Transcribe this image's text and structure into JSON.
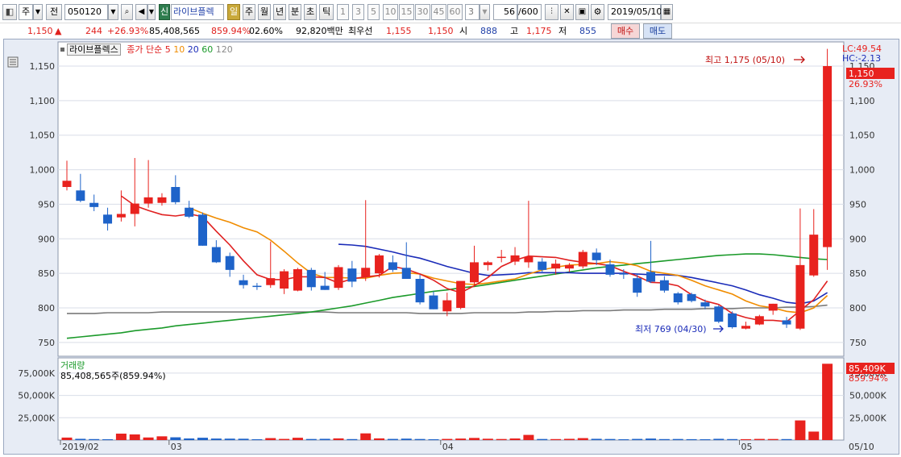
{
  "toolbar": {
    "market_label": "주",
    "prev_label": "전",
    "code_value": "050120",
    "sound_icon": "speaker-icon",
    "new_badge": "신",
    "stock_name": "라이브플렉",
    "periods": [
      "일",
      "주",
      "월",
      "년",
      "분",
      "초",
      "틱"
    ],
    "active_period": "일",
    "intervals": [
      "1",
      "3",
      "5",
      "10",
      "15",
      "30",
      "45",
      "60"
    ],
    "interval_value": "3",
    "count_value": "56",
    "count_max": "/600",
    "date_value": "2019/05/10"
  },
  "quote": {
    "price": "1,150",
    "arrow": "▲",
    "change": "244",
    "change_pct": "+26.93%",
    "volume": "85,408,565",
    "volume_ratio": "859.94%",
    "turnover": "02.60%",
    "amount": "92,820백만",
    "best_ask_label": "최우선",
    "best_ask": "1,155",
    "best_bid": "1,150",
    "open_label": "시",
    "open": "888",
    "high_label": "고",
    "high": "1,175",
    "low_label": "저",
    "low": "855",
    "buy_label": "매수",
    "sell_label": "매도"
  },
  "chart": {
    "stock_tag": "라이브플렉스",
    "ma_title": "종가 단순",
    "ma_periods": [
      "5",
      "10",
      "20",
      "60",
      "120"
    ],
    "lc_label": "LC:49.54",
    "hc_label": "HC:-2.13",
    "current_price_label": "1,150",
    "current_pct_label": "26.93%",
    "high_annotation": "최고 1,175 (05/10)",
    "low_annotation": "최저 769 (04/30)",
    "volume_title": "거래량",
    "volume_info": "85,408,565주(859.94%)",
    "volume_value_label": "85,409K",
    "volume_pct_label": "859.94%",
    "date_labels": [
      "2019/02",
      "03",
      "04",
      "05",
      "05/10"
    ],
    "colors": {
      "up": "#e8221e",
      "down": "#1e63c9",
      "ma5": "#e02020",
      "ma10": "#f08c00",
      "ma20": "#1a2bb8",
      "ma60": "#1b9a2a",
      "ma120": "#7a7a7a"
    }
  },
  "chart_data": {
    "type": "candlestick",
    "price_axis": {
      "ticks": [
        750,
        800,
        850,
        900,
        950,
        1000,
        1050,
        1100,
        1150
      ],
      "ylim": [
        730,
        1185
      ]
    },
    "volume_axis": {
      "ticks": [
        25000,
        50000,
        75000
      ],
      "unit": "K"
    },
    "candles": [
      {
        "o": 975,
        "h": 1013,
        "l": 970,
        "c": 984,
        "v": 2800
      },
      {
        "o": 970,
        "h": 994,
        "l": 953,
        "c": 955,
        "v": 1400
      },
      {
        "o": 952,
        "h": 964,
        "l": 940,
        "c": 946,
        "v": 1100
      },
      {
        "o": 935,
        "h": 945,
        "l": 912,
        "c": 922,
        "v": 900
      },
      {
        "o": 931,
        "h": 970,
        "l": 925,
        "c": 936,
        "v": 7200
      },
      {
        "o": 936,
        "h": 1017,
        "l": 918,
        "c": 951,
        "v": 6300
      },
      {
        "o": 951,
        "h": 1014,
        "l": 945,
        "c": 960,
        "v": 2900
      },
      {
        "o": 952,
        "h": 966,
        "l": 948,
        "c": 960,
        "v": 4200
      },
      {
        "o": 975,
        "h": 992,
        "l": 950,
        "c": 953,
        "v": 3100
      },
      {
        "o": 945,
        "h": 955,
        "l": 930,
        "c": 932,
        "v": 1800
      },
      {
        "o": 935,
        "h": 938,
        "l": 890,
        "c": 890,
        "v": 2600
      },
      {
        "o": 888,
        "h": 898,
        "l": 865,
        "c": 866,
        "v": 1700
      },
      {
        "o": 875,
        "h": 880,
        "l": 845,
        "c": 855,
        "v": 1600
      },
      {
        "o": 840,
        "h": 848,
        "l": 828,
        "c": 833,
        "v": 1500
      },
      {
        "o": 832,
        "h": 836,
        "l": 826,
        "c": 831,
        "v": 900
      },
      {
        "o": 833,
        "h": 896,
        "l": 829,
        "c": 843,
        "v": 2200
      },
      {
        "o": 828,
        "h": 856,
        "l": 820,
        "c": 853,
        "v": 1300
      },
      {
        "o": 825,
        "h": 858,
        "l": 824,
        "c": 856,
        "v": 2600
      },
      {
        "o": 855,
        "h": 858,
        "l": 825,
        "c": 830,
        "v": 1200
      },
      {
        "o": 832,
        "h": 852,
        "l": 826,
        "c": 826,
        "v": 1400
      },
      {
        "o": 829,
        "h": 862,
        "l": 826,
        "c": 859,
        "v": 1900
      },
      {
        "o": 857,
        "h": 868,
        "l": 830,
        "c": 838,
        "v": 1100
      },
      {
        "o": 845,
        "h": 956,
        "l": 839,
        "c": 858,
        "v": 7500
      },
      {
        "o": 850,
        "h": 878,
        "l": 844,
        "c": 876,
        "v": 1900
      },
      {
        "o": 866,
        "h": 876,
        "l": 852,
        "c": 855,
        "v": 1300
      },
      {
        "o": 858,
        "h": 895,
        "l": 842,
        "c": 842,
        "v": 1600
      },
      {
        "o": 842,
        "h": 848,
        "l": 805,
        "c": 808,
        "v": 1200
      },
      {
        "o": 818,
        "h": 824,
        "l": 798,
        "c": 798,
        "v": 900
      },
      {
        "o": 795,
        "h": 822,
        "l": 788,
        "c": 811,
        "v": 1300
      },
      {
        "o": 800,
        "h": 838,
        "l": 798,
        "c": 839,
        "v": 1700
      },
      {
        "o": 837,
        "h": 890,
        "l": 832,
        "c": 866,
        "v": 2400
      },
      {
        "o": 862,
        "h": 868,
        "l": 854,
        "c": 866,
        "v": 1500
      },
      {
        "o": 874,
        "h": 884,
        "l": 866,
        "c": 874,
        "v": 1200
      },
      {
        "o": 867,
        "h": 888,
        "l": 862,
        "c": 876,
        "v": 1800
      },
      {
        "o": 866,
        "h": 955,
        "l": 858,
        "c": 874,
        "v": 5800
      },
      {
        "o": 867,
        "h": 872,
        "l": 850,
        "c": 855,
        "v": 1200
      },
      {
        "o": 857,
        "h": 870,
        "l": 848,
        "c": 864,
        "v": 1100
      },
      {
        "o": 857,
        "h": 865,
        "l": 852,
        "c": 862,
        "v": 1400
      },
      {
        "o": 860,
        "h": 884,
        "l": 857,
        "c": 881,
        "v": 2200
      },
      {
        "o": 880,
        "h": 886,
        "l": 862,
        "c": 869,
        "v": 1400
      },
      {
        "o": 863,
        "h": 870,
        "l": 845,
        "c": 848,
        "v": 1200
      },
      {
        "o": 850,
        "h": 856,
        "l": 842,
        "c": 849,
        "v": 900
      },
      {
        "o": 843,
        "h": 850,
        "l": 816,
        "c": 822,
        "v": 1300
      },
      {
        "o": 852,
        "h": 897,
        "l": 836,
        "c": 838,
        "v": 1700
      },
      {
        "o": 840,
        "h": 846,
        "l": 822,
        "c": 825,
        "v": 1100
      },
      {
        "o": 821,
        "h": 823,
        "l": 805,
        "c": 808,
        "v": 1200
      },
      {
        "o": 820,
        "h": 822,
        "l": 808,
        "c": 810,
        "v": 1000
      },
      {
        "o": 808,
        "h": 812,
        "l": 798,
        "c": 802,
        "v": 900
      },
      {
        "o": 802,
        "h": 804,
        "l": 778,
        "c": 780,
        "v": 1400
      },
      {
        "o": 792,
        "h": 795,
        "l": 770,
        "c": 772,
        "v": 1100
      },
      {
        "o": 770,
        "h": 780,
        "l": 769,
        "c": 774,
        "v": 1000
      },
      {
        "o": 776,
        "h": 790,
        "l": 775,
        "c": 788,
        "v": 1300
      },
      {
        "o": 796,
        "h": 806,
        "l": 790,
        "c": 806,
        "v": 1200
      },
      {
        "o": 782,
        "h": 787,
        "l": 771,
        "c": 776,
        "v": 1100
      },
      {
        "o": 770,
        "h": 944,
        "l": 768,
        "c": 862,
        "v": 22000
      },
      {
        "o": 847,
        "h": 943,
        "l": 845,
        "c": 906,
        "v": 9500
      },
      {
        "o": 888,
        "h": 1175,
        "l": 855,
        "c": 1150,
        "v": 85409
      }
    ],
    "ma5": [
      null,
      null,
      null,
      null,
      962,
      948,
      941,
      935,
      933,
      936,
      932,
      911,
      891,
      868,
      848,
      841,
      841,
      845,
      845,
      844,
      836,
      842,
      845,
      847,
      860,
      856,
      849,
      840,
      828,
      822,
      832,
      844,
      860,
      869,
      875,
      874,
      873,
      869,
      866,
      864,
      861,
      853,
      846,
      837,
      836,
      832,
      819,
      810,
      805,
      792,
      786,
      782,
      782,
      780,
      796,
      812,
      839
    ],
    "ma10": [
      null,
      null,
      null,
      null,
      null,
      null,
      null,
      null,
      null,
      945,
      937,
      930,
      924,
      916,
      910,
      898,
      882,
      865,
      850,
      844,
      844,
      843,
      843,
      847,
      850,
      851,
      849,
      843,
      839,
      835,
      834,
      836,
      839,
      842,
      849,
      855,
      859,
      862,
      863,
      864,
      867,
      865,
      861,
      853,
      850,
      847,
      840,
      832,
      826,
      820,
      810,
      803,
      800,
      795,
      793,
      800,
      818
    ],
    "ma20": [
      null,
      null,
      null,
      null,
      null,
      null,
      null,
      null,
      null,
      null,
      null,
      null,
      null,
      null,
      null,
      null,
      null,
      null,
      null,
      null,
      892,
      891,
      889,
      885,
      881,
      876,
      872,
      866,
      860,
      855,
      850,
      847,
      848,
      849,
      851,
      851,
      851,
      851,
      850,
      850,
      850,
      850,
      849,
      848,
      848,
      847,
      844,
      840,
      836,
      832,
      826,
      819,
      814,
      808,
      806,
      810,
      822
    ],
    "ma60": [
      756,
      758,
      760,
      762,
      764,
      767,
      769,
      771,
      774,
      776,
      778,
      780,
      782,
      784,
      786,
      788,
      790,
      792,
      794,
      797,
      800,
      803,
      807,
      811,
      815,
      818,
      821,
      824,
      826,
      829,
      831,
      834,
      837,
      840,
      843,
      846,
      849,
      852,
      855,
      858,
      860,
      862,
      864,
      866,
      868,
      870,
      872,
      874,
      876,
      877,
      878,
      878,
      877,
      875,
      873,
      871,
      870
    ],
    "ma120": [
      792,
      792,
      792,
      793,
      793,
      793,
      793,
      794,
      794,
      794,
      794,
      794,
      794,
      794,
      794,
      794,
      794,
      794,
      794,
      794,
      793,
      793,
      793,
      793,
      793,
      793,
      792,
      792,
      792,
      792,
      793,
      793,
      793,
      793,
      794,
      794,
      795,
      795,
      796,
      796,
      796,
      797,
      797,
      797,
      798,
      798,
      798,
      799,
      799,
      799,
      800,
      800,
      800,
      801,
      801,
      802,
      804
    ]
  }
}
